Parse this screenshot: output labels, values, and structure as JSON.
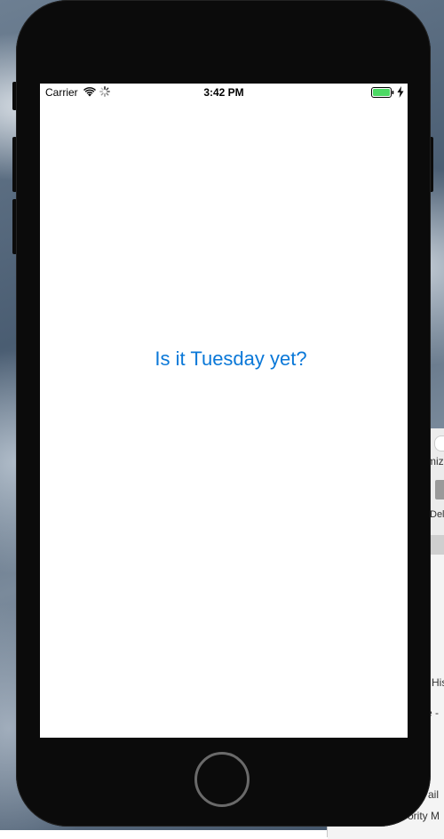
{
  "status_bar": {
    "carrier": "Carrier",
    "time": "3:42 PM",
    "wifi_icon": "wifi-icon",
    "activity_icon": "network-activity-icon",
    "battery_icon": "battery-icon",
    "charging_icon": "charging-bolt-icon",
    "battery_color": "#4cd964"
  },
  "app": {
    "label": "Is it Tuesday yet?",
    "label_color": "#0a78d8"
  },
  "device": {
    "home_button_icon": "home-button"
  },
  "background_window": {
    "fragments": [
      "miz",
      "Del",
      "His",
      "e -",
      "ail",
      "ority M"
    ]
  }
}
